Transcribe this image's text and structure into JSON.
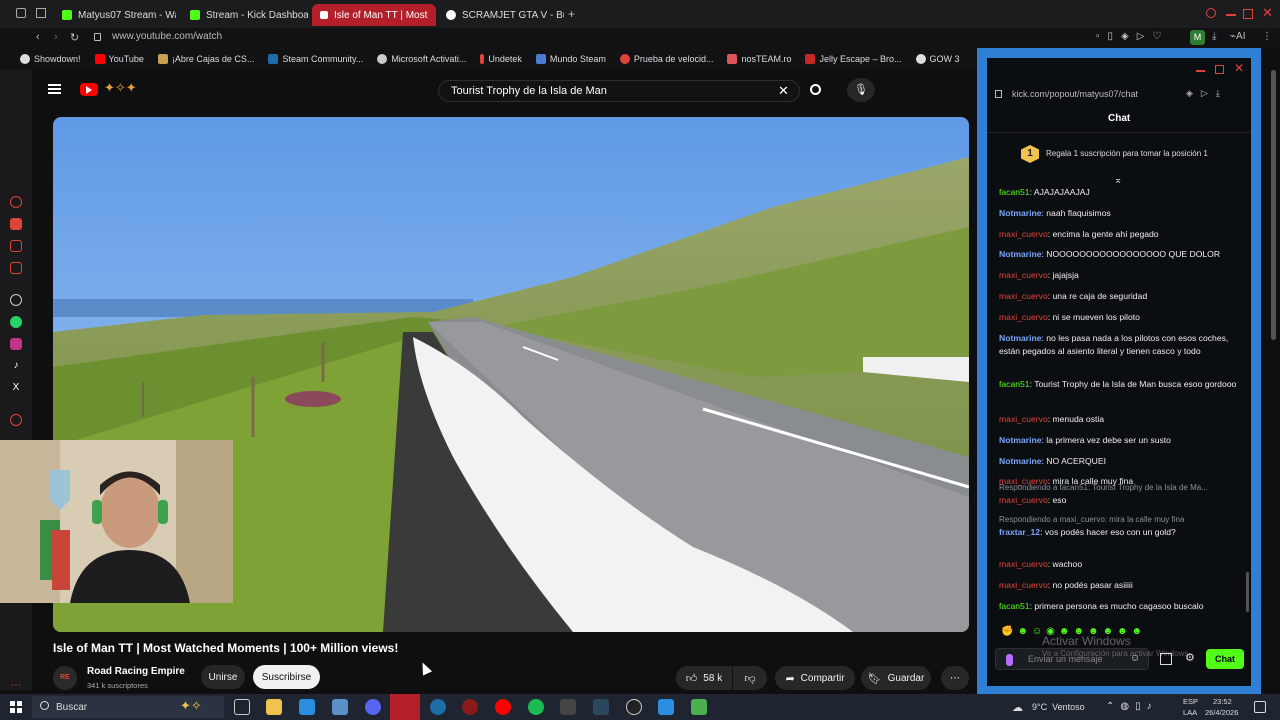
{
  "browser": {
    "tabs": [
      {
        "label": "Matyus07 Stream - Watch",
        "color": "#53fc18"
      },
      {
        "label": "Stream - Kick Dashboard",
        "color": "#53fc18"
      },
      {
        "label": "Isle of Man TT | Most",
        "color": "#ff0000"
      },
      {
        "label": "SCRAMJET GTA V - Busca",
        "color": "#4285f4"
      }
    ],
    "url": "www.youtube.com/watch",
    "bookmarks": [
      "Showdown!",
      "YouTube",
      "¡Abre Cajas de CS...",
      "Steam Community...",
      "Microsoft Activati...",
      "Undetek",
      "Mundo Steam",
      "Prueba de velocid...",
      "nosTEAM.ro",
      "Jelly Escape – Bro...",
      "GOW 3"
    ]
  },
  "youtube": {
    "search_query": "Tourist Trophy de la Isla de Man",
    "video_title": "Isle of Man TT | Most Watched Moments | 100+ Million views!",
    "channel_name": "Road Racing Empire",
    "subscribers": "341 k suscriptores",
    "join_label": "Unirse",
    "subscribe_label": "Suscribirse",
    "likes": "58 k",
    "share_label": "Compartir",
    "save_label": "Guardar"
  },
  "chat": {
    "url": "kick.com/popout/matyus07/chat",
    "header": "Chat",
    "gift_rank": "1",
    "gift_text": "Regala 1 suscripción para tomar la posición 1",
    "messages": [
      {
        "user": "facan51",
        "text": ": AJAJAJAAJAJ",
        "cls": "u-green"
      },
      {
        "user": "Notmarine",
        "text": ": naah flaquisimos",
        "cls": "u-blue"
      },
      {
        "user": "maxi_cuervo",
        "text": ": encima la gente ahí pegado",
        "cls": "u-red"
      },
      {
        "user": "Notmarine",
        "text": ": NOOOOOOOOOOOOOOOOO QUE DOLOR",
        "cls": "u-blue"
      },
      {
        "user": "maxi_cuervo",
        "text": ": jajajsja",
        "cls": "u-red"
      },
      {
        "user": "maxi_cuervo",
        "text": ": una re caja de seguridad",
        "cls": "u-red"
      },
      {
        "user": "maxi_cuervo",
        "text": ": ni se mueven los piloto",
        "cls": "u-red"
      },
      {
        "user": "Notmarine",
        "text": ": no les pasa nada a los pilotos con esos coches, están pegados al asiento literal y tienen casco y todo",
        "cls": "u-blue"
      },
      {
        "user": "facan51",
        "text": ": Tourist Trophy de la Isla de Man busca esoo gordooo",
        "cls": "u-green"
      },
      {
        "user": "maxi_cuervo",
        "text": ": menuda ostia",
        "cls": "u-red"
      },
      {
        "user": "Notmarine",
        "text": ": la primera vez debe ser un susto",
        "cls": "u-blue"
      },
      {
        "user": "Notmarine",
        "text": ": NO ACERQUEI",
        "cls": "u-blue"
      },
      {
        "user": "maxi_cuervo",
        "text": ": mira la calle muy fina",
        "cls": "u-red"
      },
      {
        "reply": "Respondiendo a facan51: Tourist Trophy de la Isla de Ma...",
        "user": "maxi_cuervo",
        "text": ": eso",
        "cls": "u-red"
      },
      {
        "reply": "Respondiendo a maxi_cuervo: mira la calle muy fina",
        "user": "fraxtar_12",
        "text": ": vos podés hacer eso con un gold?",
        "cls": "u-blue"
      },
      {
        "user": "maxi_cuervo",
        "text": ": wachoo",
        "cls": "u-red"
      },
      {
        "user": "maxi_cuervo",
        "text": ": no podés pasar asiiiii",
        "cls": "u-red"
      },
      {
        "user": "facan51",
        "text": ": primera persona es mucho cagasoo buscalo",
        "cls": "u-green"
      }
    ],
    "input_placeholder": "Enviar un mensaje",
    "send_label": "Chat",
    "watermark_title": "Activar Windows",
    "watermark_sub": "Ve a Configuración para activar Windows."
  },
  "taskbar": {
    "search_placeholder": "Buscar",
    "weather": "9°C  Ventoso",
    "lang_top": "ESP",
    "lang_bottom": "LAA",
    "time": "23:52",
    "date": "26/4/2026"
  },
  "colors": {
    "chat_border": "#2f7fd4",
    "kick_green": "#53fc18",
    "yt_red": "#ff0000"
  }
}
